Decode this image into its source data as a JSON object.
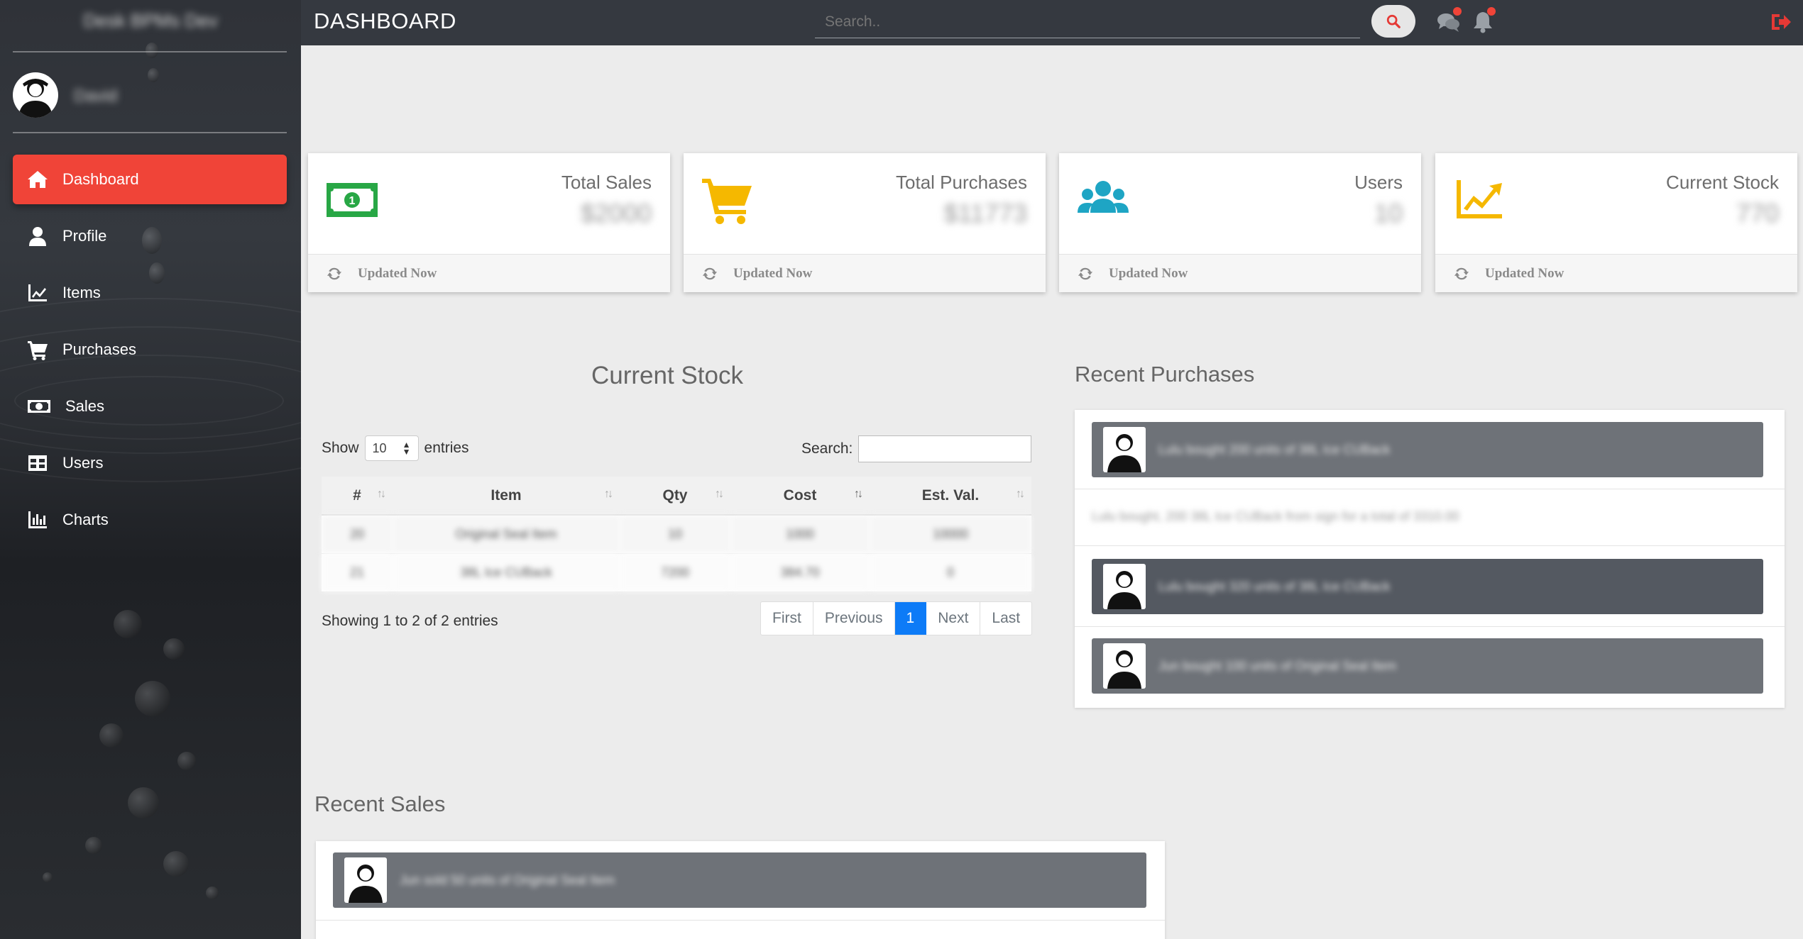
{
  "app": {
    "brand": "Desk BPMs Dev",
    "user_name": "David"
  },
  "sidebar": {
    "items": [
      {
        "label": "Dashboard",
        "icon": "home-icon",
        "active": true
      },
      {
        "label": "Profile",
        "icon": "user-icon"
      },
      {
        "label": "Items",
        "icon": "chart-line-icon"
      },
      {
        "label": "Purchases",
        "icon": "cart-icon"
      },
      {
        "label": "Sales",
        "icon": "money-icon"
      },
      {
        "label": "Users",
        "icon": "table-icon"
      },
      {
        "label": "Charts",
        "icon": "bar-chart-icon"
      }
    ]
  },
  "header": {
    "title": "DASHBOARD",
    "search_placeholder": "Search..",
    "icons": [
      "search-icon",
      "comments-icon",
      "bell-icon",
      "logout-icon"
    ]
  },
  "cards": [
    {
      "label": "Total Sales",
      "value": "$2000",
      "footer": "Updated Now",
      "icon": "money-bill-icon",
      "color": "#28a745"
    },
    {
      "label": "Total Purchases",
      "value": "$11773",
      "footer": "Updated Now",
      "icon": "cart-icon",
      "color": "#f5b800"
    },
    {
      "label": "Users",
      "value": "10",
      "footer": "Updated Now",
      "icon": "users-icon",
      "color": "#1ea5c4"
    },
    {
      "label": "Current Stock",
      "value": "770",
      "footer": "Updated Now",
      "icon": "chart-line-icon",
      "color": "#f5b800"
    }
  ],
  "stock": {
    "title": "Current Stock",
    "show_label": "Show",
    "entries_label": "entries",
    "page_length": "10",
    "search_label": "Search:",
    "columns": [
      "#",
      "Item",
      "Qty",
      "Cost",
      "Est. Val."
    ],
    "rows": [
      [
        "20",
        "Original Seal Item",
        "10",
        "1000",
        "10000"
      ],
      [
        "21",
        "38L Ice CUBack",
        "7200",
        "384.70",
        "0"
      ]
    ],
    "info": "Showing 1 to 2 of 2 entries",
    "pagination": [
      "First",
      "Previous",
      "1",
      "Next",
      "Last"
    ]
  },
  "recent_purchases": {
    "title": "Recent Purchases",
    "entries": [
      {
        "text": "Lulu bought 200 units of 38L Ice CUBack",
        "style": "light",
        "avatar": true
      },
      {
        "text": "Lulu bought, 200 38L Ice CUBack from sign for a total of 3310.00",
        "style": "plain",
        "avatar": false
      },
      {
        "text": "Lulu bought 320 units of 38L Ice CUBack",
        "style": "dark",
        "avatar": true
      },
      {
        "text": "Jun bought 100 units of Original Seal Item",
        "style": "light",
        "avatar": true
      }
    ]
  },
  "recent_sales": {
    "title": "Recent Sales",
    "entries": [
      {
        "text": "Jun sold 50 units of Original Seal Item",
        "style": "light",
        "avatar": true
      }
    ]
  }
}
